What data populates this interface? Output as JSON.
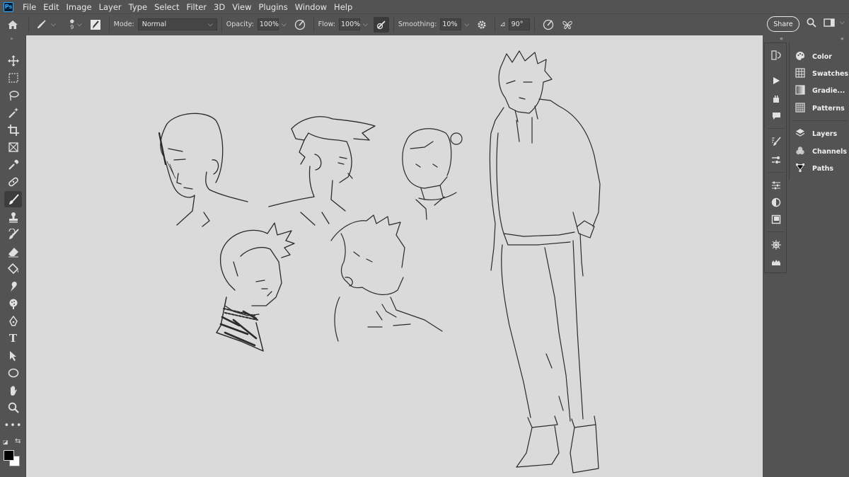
{
  "app": {
    "logo": "Ps"
  },
  "menu": [
    "File",
    "Edit",
    "Image",
    "Layer",
    "Type",
    "Select",
    "Filter",
    "3D",
    "View",
    "Plugins",
    "Window",
    "Help"
  ],
  "options": {
    "brush_size": "9",
    "mode_label": "Mode:",
    "mode_value": "Normal",
    "opacity_label": "Opacity:",
    "opacity_value": "100%",
    "flow_label": "Flow:",
    "flow_value": "100%",
    "smoothing_label": "Smoothing:",
    "smoothing_value": "10%",
    "angle_value": "90°",
    "share_label": "Share"
  },
  "tools": {
    "active": "brush-tool",
    "items": [
      "move-tool",
      "marquee-tool",
      "lasso-tool",
      "magic-wand-tool",
      "crop-tool",
      "frame-tool",
      "eyedropper-tool",
      "healing-brush-tool",
      "brush-tool",
      "clone-stamp-tool",
      "history-brush-tool",
      "eraser-tool",
      "paint-bucket-tool",
      "smudge-tool",
      "dodge-tool",
      "pen-tool",
      "type-tool",
      "path-selection-tool",
      "ellipse-tool",
      "hand-tool",
      "zoom-tool",
      "edit-toolbar"
    ]
  },
  "colors": {
    "foreground": "#000000",
    "background": "#ffffff",
    "canvas": "#dadada",
    "chrome": "#535353"
  },
  "panels": {
    "group1": [
      "Color",
      "Swatches",
      "Gradie...",
      "Patterns"
    ],
    "group2": [
      "Layers",
      "Channels",
      "Paths"
    ]
  }
}
